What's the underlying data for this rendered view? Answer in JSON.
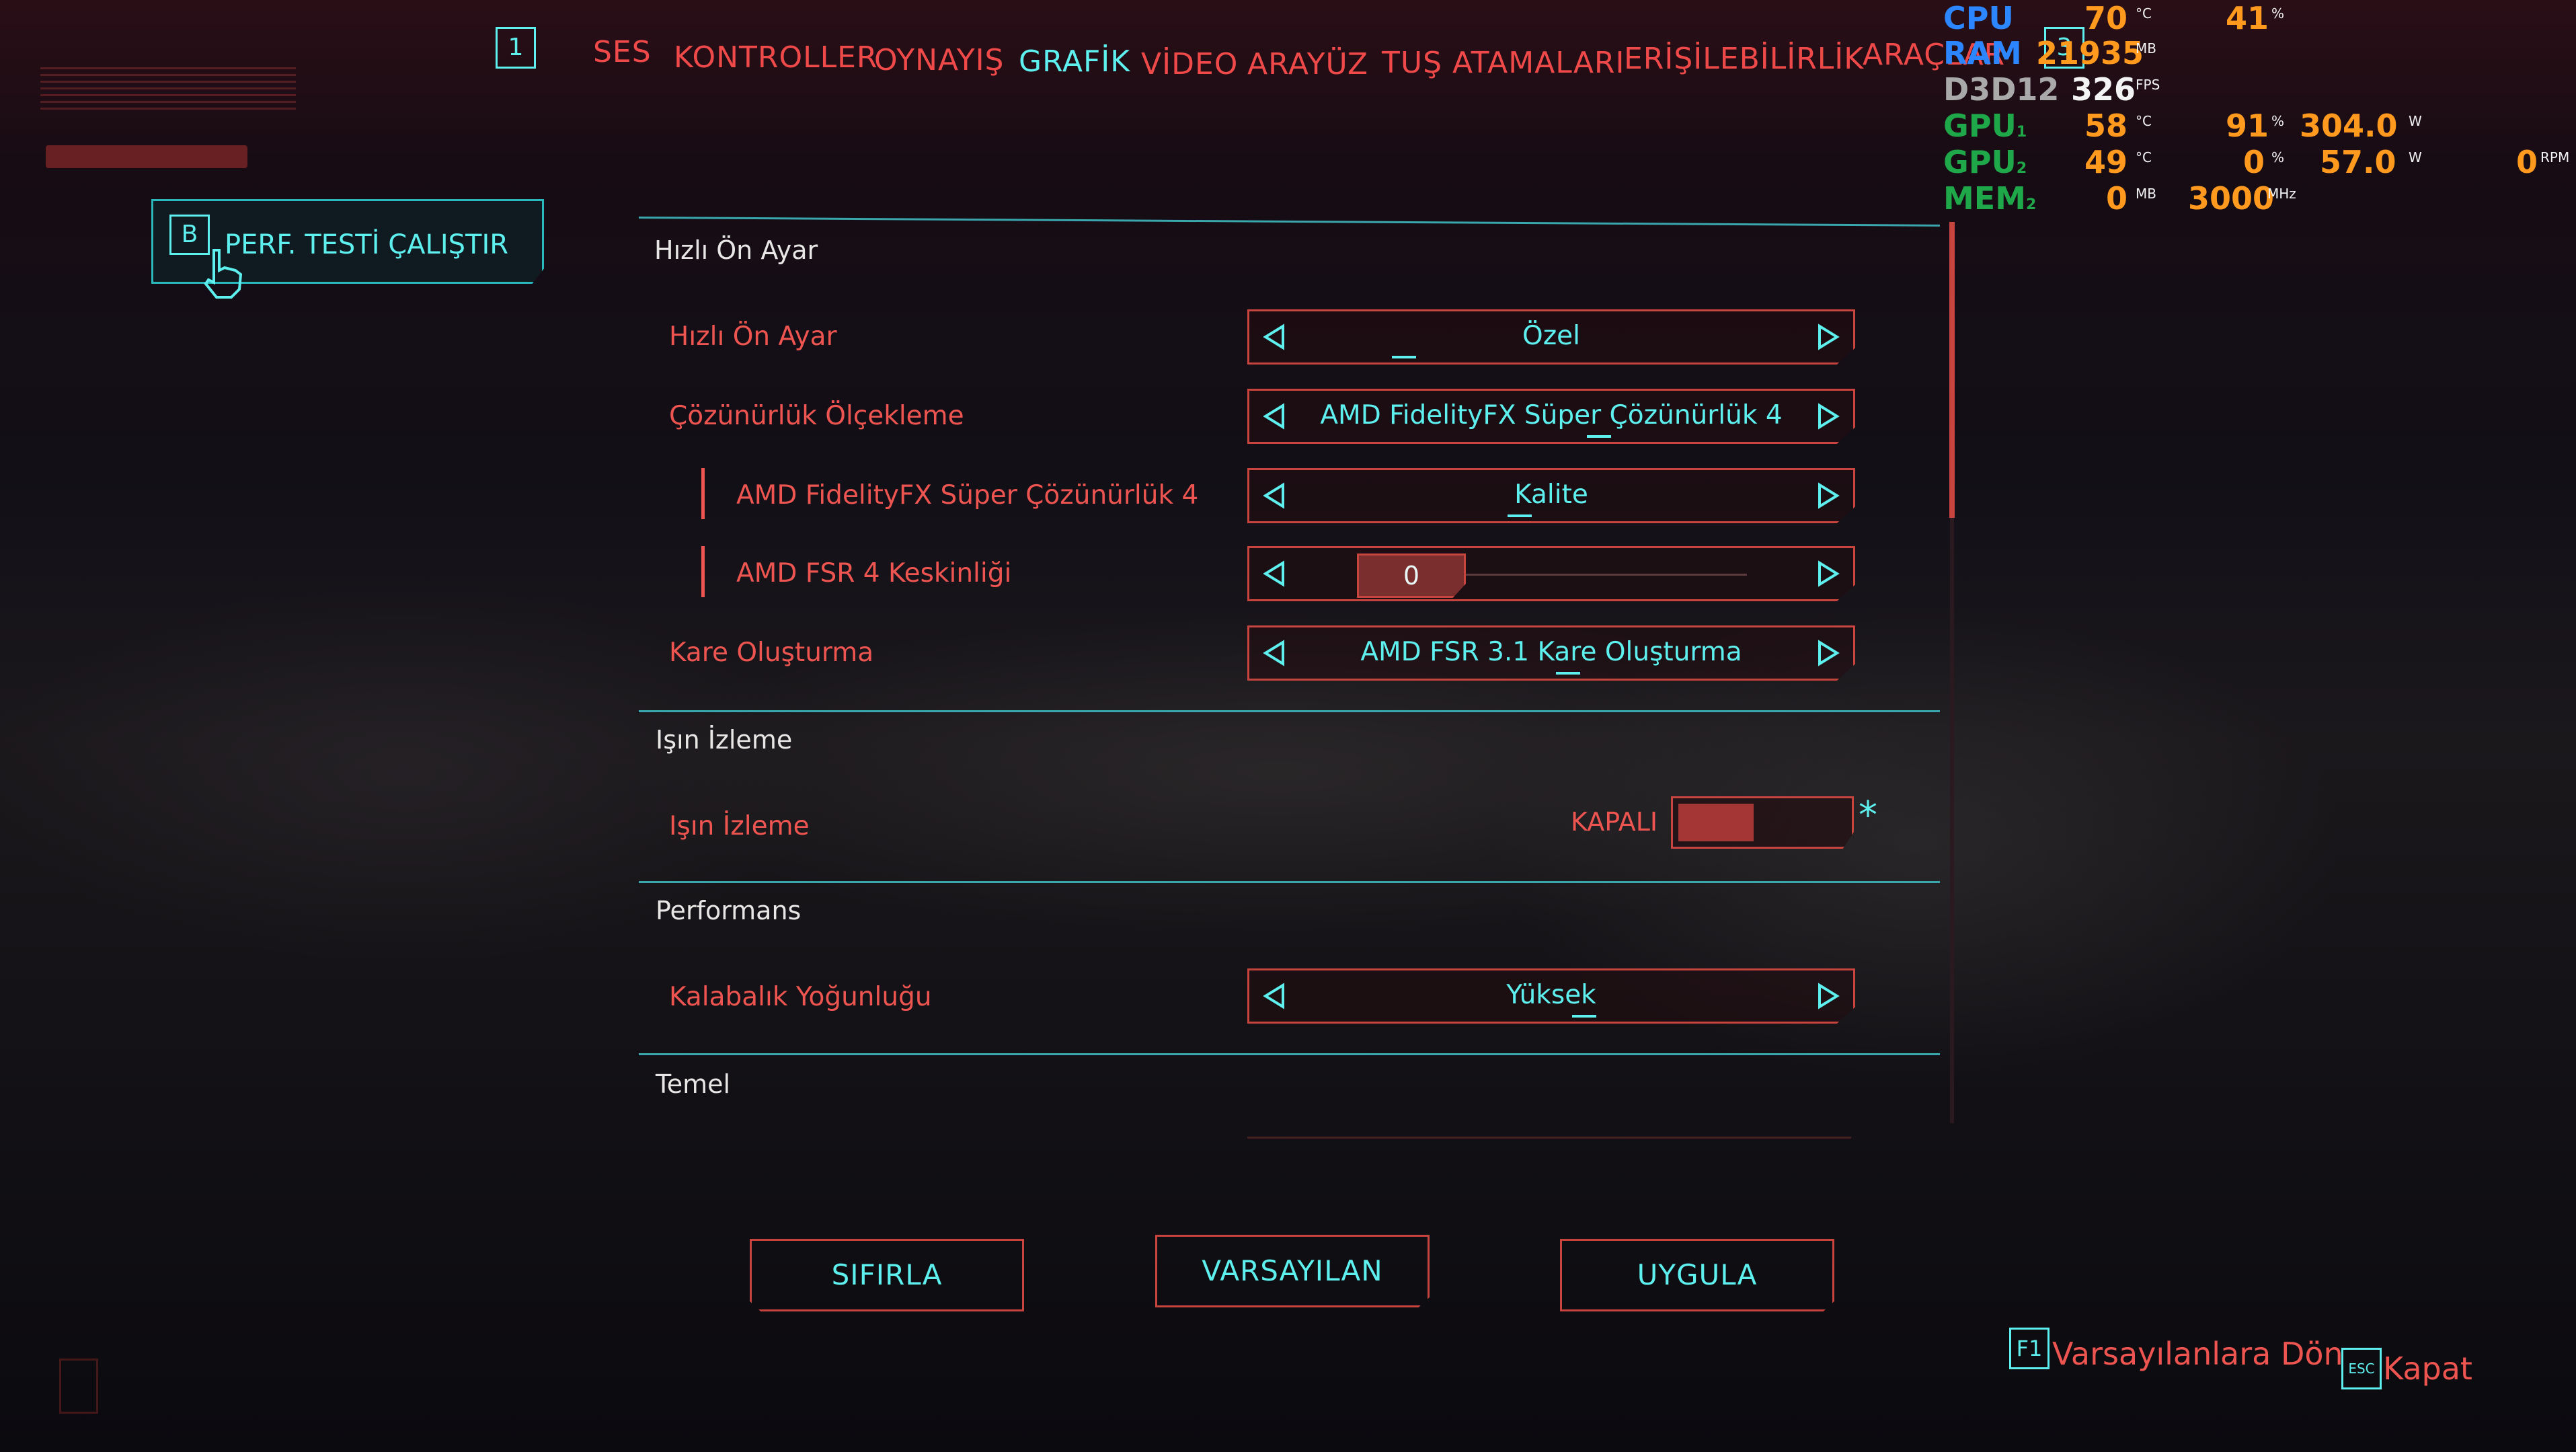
{
  "nav": {
    "left_key": "1",
    "tabs": [
      {
        "label": "SES",
        "active": false
      },
      {
        "label": "KONTROLLER",
        "active": false
      },
      {
        "label": "OYNAYIŞ",
        "active": false
      },
      {
        "label": "GRAFİK",
        "active": true
      },
      {
        "label": "VİDEO",
        "active": false
      },
      {
        "label": "ARAYÜZ",
        "active": false
      },
      {
        "label": "TUŞ ATAMALARI",
        "active": false
      },
      {
        "label": "ERİŞİLEBİLİRLİK",
        "active": false
      },
      {
        "label": "ARAÇLAR",
        "active": false
      }
    ],
    "right_key": "3"
  },
  "benchmark": {
    "key": "B",
    "label": "PERF. TESTİ ÇALIŞTIR"
  },
  "sections": {
    "quick_preset": "Hızlı Ön Ayar",
    "ray_tracing": "Işın İzleme",
    "performance": "Performans",
    "basic": "Temel"
  },
  "settings": {
    "quick_preset": {
      "label": "Hızlı Ön Ayar",
      "value": "Özel"
    },
    "resolution_scaling": {
      "label": "Çözünürlük Ölçekleme",
      "value": "AMD FidelityFX Süper Çözünürlük 4"
    },
    "fsr4": {
      "label": "AMD FidelityFX Süper Çözünürlük 4",
      "value": "Kalite"
    },
    "fsr4_sharpness": {
      "label": "AMD FSR 4 Keskinliği",
      "value": "0"
    },
    "frame_generation": {
      "label": "Kare Oluşturma",
      "value": "AMD FSR 3.1 Kare Oluşturma"
    },
    "ray_tracing": {
      "label": "Işın İzleme",
      "state": "KAPALI",
      "asterisk": "*"
    },
    "crowd_density": {
      "label": "Kalabalık Yoğunluğu",
      "value": "Yüksek"
    }
  },
  "buttons": {
    "reset": "SIFIRLA",
    "default": "VARSAYILAN",
    "apply": "UYGULA"
  },
  "footer": {
    "f1_key": "F1",
    "f1_label": "Varsayılanlara Dön",
    "esc_key": "ESC",
    "esc_label": "Kapat"
  },
  "overlay": {
    "cpu": {
      "label": "CPU",
      "temp": "70",
      "temp_unit": "°C",
      "load": "41",
      "load_unit": "%"
    },
    "ram": {
      "label": "RAM",
      "value": "21935",
      "unit": "MB"
    },
    "d3d12": {
      "label": "D3D12",
      "fps": "326",
      "unit": "FPS"
    },
    "gpu1": {
      "label": "GPU",
      "sub": "1",
      "temp": "58",
      "temp_unit": "°C",
      "load": "91",
      "load_unit": "%",
      "power": "304.0",
      "power_unit": "W"
    },
    "gpu2": {
      "label": "GPU",
      "sub": "2",
      "temp": "49",
      "temp_unit": "°C",
      "load": "0",
      "load_unit": "%",
      "power": "57.0",
      "power_unit": "W",
      "fan": "0",
      "fan_unit": "RPM"
    },
    "mem2": {
      "label": "MEM",
      "sub": "2",
      "value": "0",
      "unit": "MB",
      "clock": "3000",
      "clock_unit": "MHz"
    }
  },
  "colors": {
    "accent_cyan": "#5ef0ee",
    "accent_red": "#f2544f",
    "hud_blue": "#2c86ff",
    "hud_green": "#1fa84a",
    "hud_orange": "#ff9a1e"
  }
}
